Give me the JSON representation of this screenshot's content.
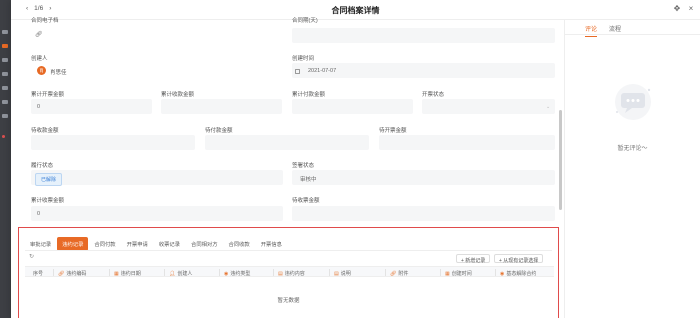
{
  "header": {
    "pager": "1/6",
    "prev_icon": "chevron-left-icon",
    "next_icon": "chevron-right-icon",
    "title": "合同档案详情",
    "actions": [
      "puzzle-icon",
      "close-icon"
    ]
  },
  "form": {
    "partial_labels": {
      "contract_attachment": "合同电子档",
      "contract_period": "合同期(天)"
    },
    "creator": {
      "label": "创建人",
      "avatar_text": "肖",
      "name": "肖思佳"
    },
    "create_time": {
      "label": "创建时间",
      "value": "2021-07-07"
    },
    "invoiced_amount": {
      "label": "累计开票金额",
      "value": "0"
    },
    "received_amount": {
      "label": "累计收款金额",
      "value": ""
    },
    "paid_amount": {
      "label": "累计付款金额",
      "value": ""
    },
    "invoice_status": {
      "label": "开票状态",
      "value": ""
    },
    "pending_receipt": {
      "label": "待收款金额",
      "value": ""
    },
    "pending_payment": {
      "label": "待付款金额",
      "value": ""
    },
    "pending_invoice": {
      "label": "待开票金额",
      "value": ""
    },
    "perform_status": {
      "label": "履行状态",
      "value": "已解除"
    },
    "approval_status": {
      "label": "签署状态",
      "value": "审核中"
    },
    "invoice_received": {
      "label": "累计收票金额",
      "value": "0"
    },
    "pending_invoice_receipt": {
      "label": "待收票金额",
      "value": ""
    }
  },
  "related": {
    "tabs": [
      "审批记录",
      "违约记录",
      "合同付款",
      "开票申请",
      "收票记录",
      "合同相对方",
      "合同收款",
      "开票信息"
    ],
    "active_tab": 1,
    "buttons": {
      "add": "+ 新增记录",
      "select": "+ 从现有记录选择"
    },
    "columns": [
      "序号",
      "违约编码",
      "违约日期",
      "创建人",
      "违约类型",
      "违约内容",
      "说明",
      "附件",
      "创建时间",
      "基态解除合约"
    ],
    "empty_text": "暂无数据"
  },
  "sidebar": {
    "tabs": [
      "评论",
      "流程"
    ],
    "active_tab": 0,
    "empty_icon": "chat-bubble-icon",
    "empty_text": "暂无评论～"
  },
  "colors": {
    "accent": "#e86a26",
    "highlight_border": "#e04b4b",
    "tag_blue": "#3a7fd6"
  }
}
